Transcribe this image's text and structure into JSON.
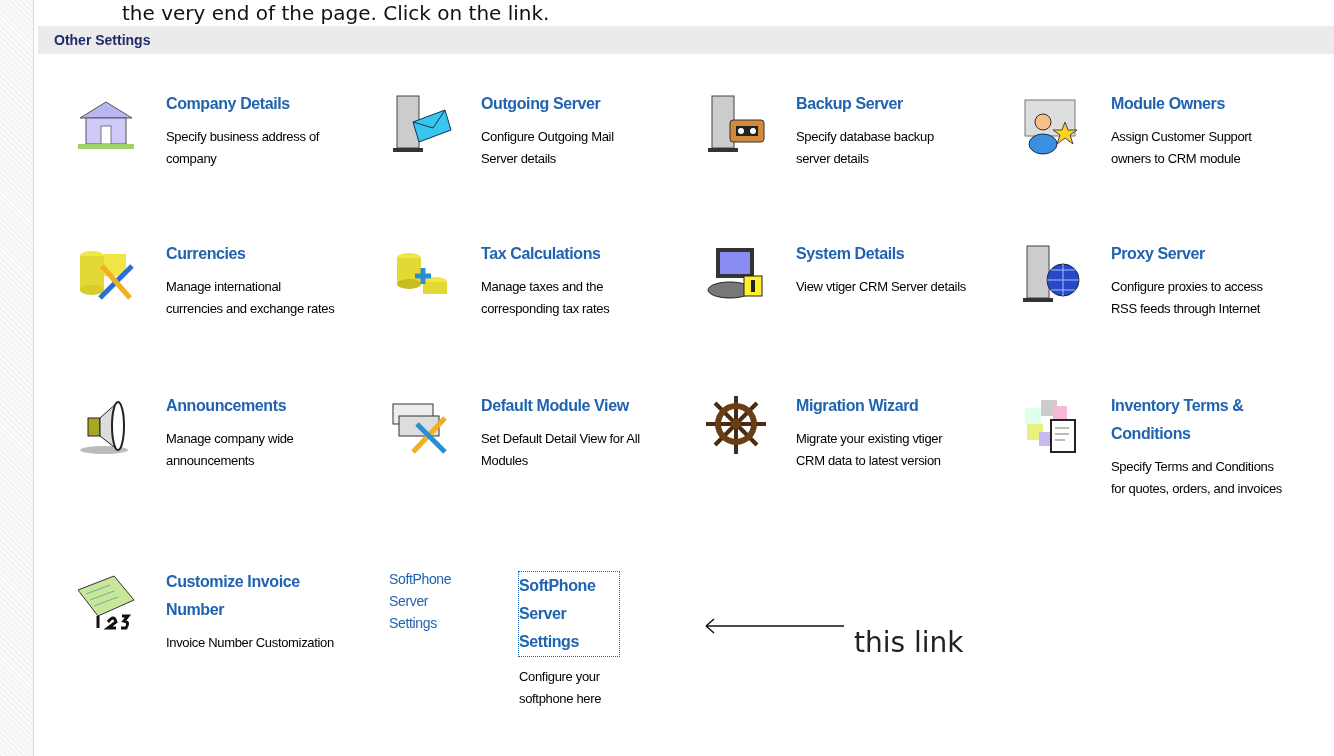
{
  "caption": "the very end of the page. Click on the link.",
  "section": {
    "title": "Other Settings"
  },
  "items": [
    {
      "kind": "setting",
      "title": "Company Details",
      "description": "Specify business address of company"
    },
    {
      "kind": "setting",
      "title": "Outgoing Server",
      "description": "Configure Outgoing Mail Server details"
    },
    {
      "kind": "setting",
      "title": "Backup Server",
      "description": "Specify database backup server details"
    },
    {
      "kind": "setting",
      "title": "Module Owners",
      "description": "Assign Customer Support owners to CRM module"
    },
    {
      "kind": "setting",
      "title": "Currencies",
      "description": "Manage international currencies and exchange rates"
    },
    {
      "kind": "setting",
      "title": "Tax Calculations",
      "description": "Manage taxes and the corresponding tax rates"
    },
    {
      "kind": "setting",
      "title": "System Details",
      "description": "View vtiger CRM Server details"
    },
    {
      "kind": "setting",
      "title": "Proxy Server",
      "description": "Configure proxies to access RSS feeds through Internet"
    },
    {
      "kind": "setting",
      "title": "Announcements",
      "description": "Manage company wide announcements"
    },
    {
      "kind": "setting",
      "title": "Default Module View",
      "description": "Set Default Detail View for All Modules"
    },
    {
      "kind": "setting",
      "title": "Migration Wizard",
      "description": "Migrate your existing vtiger CRM data to latest version"
    },
    {
      "kind": "setting",
      "title": "Inventory Terms & Conditions",
      "description": "Specify Terms and Conditions for quotes, orders, and invoices"
    },
    {
      "kind": "setting",
      "title": "Customize Invoice Number",
      "description": "Invoice Number Customization"
    },
    {
      "kind": "softphone",
      "label": "SoftPhone Server Settings",
      "title": "SoftPhone Server Settings",
      "focused": true,
      "description": "Configure your softphone here"
    },
    {
      "kind": "annotation",
      "text": "this link"
    }
  ]
}
